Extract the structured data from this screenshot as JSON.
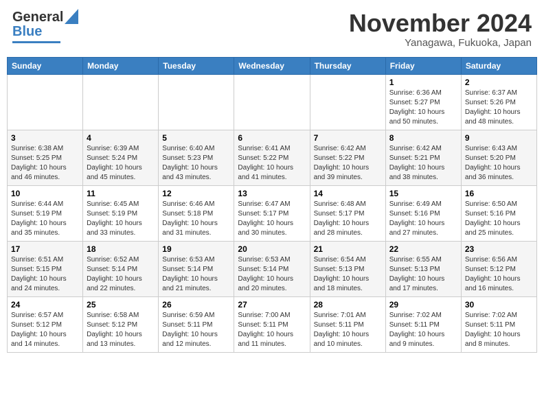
{
  "header": {
    "logo_general": "General",
    "logo_blue": "Blue",
    "month_title": "November 2024",
    "location": "Yanagawa, Fukuoka, Japan"
  },
  "weekdays": [
    "Sunday",
    "Monday",
    "Tuesday",
    "Wednesday",
    "Thursday",
    "Friday",
    "Saturday"
  ],
  "weeks": [
    [
      {
        "day": "",
        "sunrise": "",
        "sunset": "",
        "daylight": ""
      },
      {
        "day": "",
        "sunrise": "",
        "sunset": "",
        "daylight": ""
      },
      {
        "day": "",
        "sunrise": "",
        "sunset": "",
        "daylight": ""
      },
      {
        "day": "",
        "sunrise": "",
        "sunset": "",
        "daylight": ""
      },
      {
        "day": "",
        "sunrise": "",
        "sunset": "",
        "daylight": ""
      },
      {
        "day": "1",
        "sunrise": "Sunrise: 6:36 AM",
        "sunset": "Sunset: 5:27 PM",
        "daylight": "Daylight: 10 hours and 50 minutes."
      },
      {
        "day": "2",
        "sunrise": "Sunrise: 6:37 AM",
        "sunset": "Sunset: 5:26 PM",
        "daylight": "Daylight: 10 hours and 48 minutes."
      }
    ],
    [
      {
        "day": "3",
        "sunrise": "Sunrise: 6:38 AM",
        "sunset": "Sunset: 5:25 PM",
        "daylight": "Daylight: 10 hours and 46 minutes."
      },
      {
        "day": "4",
        "sunrise": "Sunrise: 6:39 AM",
        "sunset": "Sunset: 5:24 PM",
        "daylight": "Daylight: 10 hours and 45 minutes."
      },
      {
        "day": "5",
        "sunrise": "Sunrise: 6:40 AM",
        "sunset": "Sunset: 5:23 PM",
        "daylight": "Daylight: 10 hours and 43 minutes."
      },
      {
        "day": "6",
        "sunrise": "Sunrise: 6:41 AM",
        "sunset": "Sunset: 5:22 PM",
        "daylight": "Daylight: 10 hours and 41 minutes."
      },
      {
        "day": "7",
        "sunrise": "Sunrise: 6:42 AM",
        "sunset": "Sunset: 5:22 PM",
        "daylight": "Daylight: 10 hours and 39 minutes."
      },
      {
        "day": "8",
        "sunrise": "Sunrise: 6:42 AM",
        "sunset": "Sunset: 5:21 PM",
        "daylight": "Daylight: 10 hours and 38 minutes."
      },
      {
        "day": "9",
        "sunrise": "Sunrise: 6:43 AM",
        "sunset": "Sunset: 5:20 PM",
        "daylight": "Daylight: 10 hours and 36 minutes."
      }
    ],
    [
      {
        "day": "10",
        "sunrise": "Sunrise: 6:44 AM",
        "sunset": "Sunset: 5:19 PM",
        "daylight": "Daylight: 10 hours and 35 minutes."
      },
      {
        "day": "11",
        "sunrise": "Sunrise: 6:45 AM",
        "sunset": "Sunset: 5:19 PM",
        "daylight": "Daylight: 10 hours and 33 minutes."
      },
      {
        "day": "12",
        "sunrise": "Sunrise: 6:46 AM",
        "sunset": "Sunset: 5:18 PM",
        "daylight": "Daylight: 10 hours and 31 minutes."
      },
      {
        "day": "13",
        "sunrise": "Sunrise: 6:47 AM",
        "sunset": "Sunset: 5:17 PM",
        "daylight": "Daylight: 10 hours and 30 minutes."
      },
      {
        "day": "14",
        "sunrise": "Sunrise: 6:48 AM",
        "sunset": "Sunset: 5:17 PM",
        "daylight": "Daylight: 10 hours and 28 minutes."
      },
      {
        "day": "15",
        "sunrise": "Sunrise: 6:49 AM",
        "sunset": "Sunset: 5:16 PM",
        "daylight": "Daylight: 10 hours and 27 minutes."
      },
      {
        "day": "16",
        "sunrise": "Sunrise: 6:50 AM",
        "sunset": "Sunset: 5:16 PM",
        "daylight": "Daylight: 10 hours and 25 minutes."
      }
    ],
    [
      {
        "day": "17",
        "sunrise": "Sunrise: 6:51 AM",
        "sunset": "Sunset: 5:15 PM",
        "daylight": "Daylight: 10 hours and 24 minutes."
      },
      {
        "day": "18",
        "sunrise": "Sunrise: 6:52 AM",
        "sunset": "Sunset: 5:14 PM",
        "daylight": "Daylight: 10 hours and 22 minutes."
      },
      {
        "day": "19",
        "sunrise": "Sunrise: 6:53 AM",
        "sunset": "Sunset: 5:14 PM",
        "daylight": "Daylight: 10 hours and 21 minutes."
      },
      {
        "day": "20",
        "sunrise": "Sunrise: 6:53 AM",
        "sunset": "Sunset: 5:14 PM",
        "daylight": "Daylight: 10 hours and 20 minutes."
      },
      {
        "day": "21",
        "sunrise": "Sunrise: 6:54 AM",
        "sunset": "Sunset: 5:13 PM",
        "daylight": "Daylight: 10 hours and 18 minutes."
      },
      {
        "day": "22",
        "sunrise": "Sunrise: 6:55 AM",
        "sunset": "Sunset: 5:13 PM",
        "daylight": "Daylight: 10 hours and 17 minutes."
      },
      {
        "day": "23",
        "sunrise": "Sunrise: 6:56 AM",
        "sunset": "Sunset: 5:12 PM",
        "daylight": "Daylight: 10 hours and 16 minutes."
      }
    ],
    [
      {
        "day": "24",
        "sunrise": "Sunrise: 6:57 AM",
        "sunset": "Sunset: 5:12 PM",
        "daylight": "Daylight: 10 hours and 14 minutes."
      },
      {
        "day": "25",
        "sunrise": "Sunrise: 6:58 AM",
        "sunset": "Sunset: 5:12 PM",
        "daylight": "Daylight: 10 hours and 13 minutes."
      },
      {
        "day": "26",
        "sunrise": "Sunrise: 6:59 AM",
        "sunset": "Sunset: 5:11 PM",
        "daylight": "Daylight: 10 hours and 12 minutes."
      },
      {
        "day": "27",
        "sunrise": "Sunrise: 7:00 AM",
        "sunset": "Sunset: 5:11 PM",
        "daylight": "Daylight: 10 hours and 11 minutes."
      },
      {
        "day": "28",
        "sunrise": "Sunrise: 7:01 AM",
        "sunset": "Sunset: 5:11 PM",
        "daylight": "Daylight: 10 hours and 10 minutes."
      },
      {
        "day": "29",
        "sunrise": "Sunrise: 7:02 AM",
        "sunset": "Sunset: 5:11 PM",
        "daylight": "Daylight: 10 hours and 9 minutes."
      },
      {
        "day": "30",
        "sunrise": "Sunrise: 7:02 AM",
        "sunset": "Sunset: 5:11 PM",
        "daylight": "Daylight: 10 hours and 8 minutes."
      }
    ]
  ]
}
